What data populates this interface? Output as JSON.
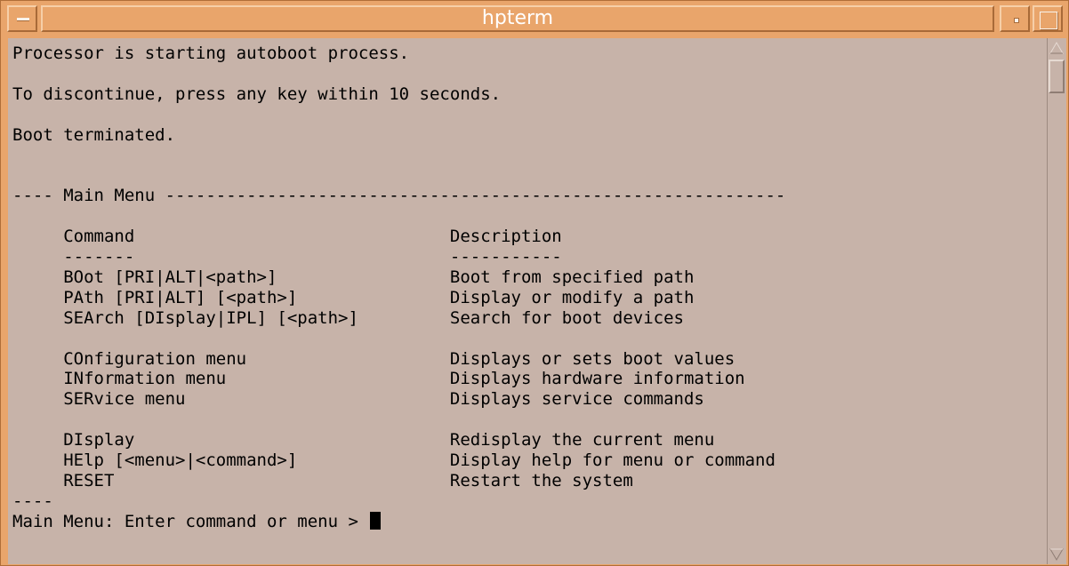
{
  "window": {
    "title": "hpterm"
  },
  "terminal": {
    "lines": [
      "Processor is starting autoboot process.",
      "",
      "To discontinue, press any key within 10 seconds.",
      "",
      "Boot terminated.",
      "",
      "",
      "---- Main Menu -------------------------------------------------------------",
      "",
      "     Command                               Description",
      "     -------                               -----------",
      "     BOot [PRI|ALT|<path>]                 Boot from specified path",
      "     PAth [PRI|ALT] [<path>]               Display or modify a path",
      "     SEArch [DIsplay|IPL] [<path>]         Search for boot devices",
      "",
      "     COnfiguration menu                    Displays or sets boot values",
      "     INformation menu                      Displays hardware information",
      "     SERvice menu                          Displays service commands",
      "",
      "     DIsplay                               Redisplay the current menu",
      "     HElp [<menu>|<command>]               Display help for menu or command",
      "     RESET                                 Restart the system",
      "----"
    ],
    "prompt": "Main Menu: Enter command or menu > "
  },
  "icons": {
    "window_menu": "window-menu-icon",
    "minimize": "minimize-icon",
    "maximize": "maximize-icon",
    "scroll_up": "scroll-up-arrow-icon",
    "scroll_down": "scroll-down-arrow-icon"
  },
  "colors": {
    "frame": "#e9a56b",
    "terminal_bg": "#c7b3a9",
    "text": "#000000",
    "title_text": "#ffffff"
  }
}
